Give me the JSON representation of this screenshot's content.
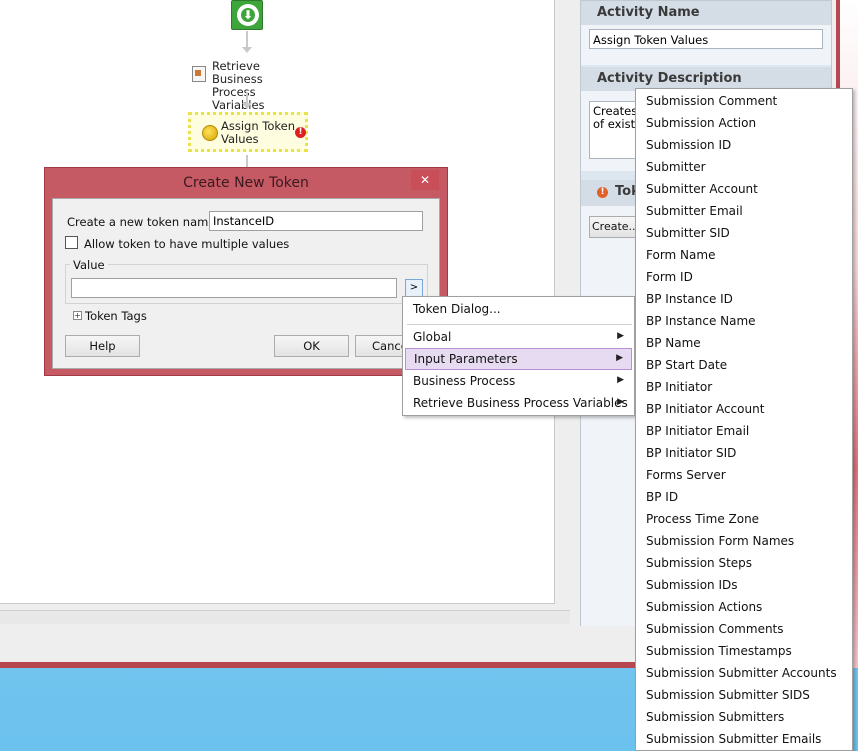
{
  "colors": {
    "window_frame": "#b7474f",
    "dialog_frame": "#c55a64",
    "menu_active_bg": "#e6dbf0",
    "start_node": "#3ea53a",
    "desktop": "#6cc2ee"
  },
  "workflow": {
    "retrieve_label_1": "Retrieve Business",
    "retrieve_label_2": "Process Variables",
    "assign_label_1": "Assign Token",
    "assign_label_2": "Values"
  },
  "right_panel": {
    "activity_name_header": "Activity Name",
    "activity_name_value": "Assign Token Values",
    "activity_description_header": "Activity Description",
    "description_line_1": "Creates n",
    "description_line_2": "of existing",
    "tokens_header": "Tok",
    "create_button": "Create..."
  },
  "dialog": {
    "title": "Create New Token",
    "close_symbol": "✕",
    "token_name_label": "Create a new token named:",
    "token_name_value": "InstanceID",
    "multiple_values_label": "Allow token to have multiple values",
    "value_group_label": "Value",
    "value_input": "",
    "picker_button": ">",
    "token_tags_label": "Token Tags",
    "help_button": "Help",
    "ok_button": "OK",
    "cancel_button": "Cance"
  },
  "context_menu": {
    "items": [
      {
        "label": "Token Dialog...",
        "submenu": false
      },
      {
        "label": "Global",
        "submenu": true
      },
      {
        "label": "Input Parameters",
        "submenu": true
      },
      {
        "label": "Business Process",
        "submenu": true
      },
      {
        "label": "Retrieve Business Process Variables",
        "submenu": true
      }
    ],
    "chevron": "▶"
  },
  "token_list": {
    "items": [
      "Submission Comment",
      "Submission Action",
      "Submission ID",
      "Submitter",
      "Submitter Account",
      "Submitter Email",
      "Submitter SID",
      "Form Name",
      "Form ID",
      "BP Instance ID",
      "BP Instance Name",
      "BP Name",
      "BP Start Date",
      "BP Initiator",
      "BP Initiator Account",
      "BP Initiator Email",
      "BP Initiator SID",
      "Forms Server",
      "BP ID",
      "Process Time Zone",
      "Submission Form Names",
      "Submission Steps",
      "Submission IDs",
      "Submission Actions",
      "Submission Comments",
      "Submission Timestamps",
      "Submission Submitter Accounts",
      "Submission Submitter SIDS",
      "Submission Submitters",
      "Submission Submitter Emails"
    ]
  }
}
